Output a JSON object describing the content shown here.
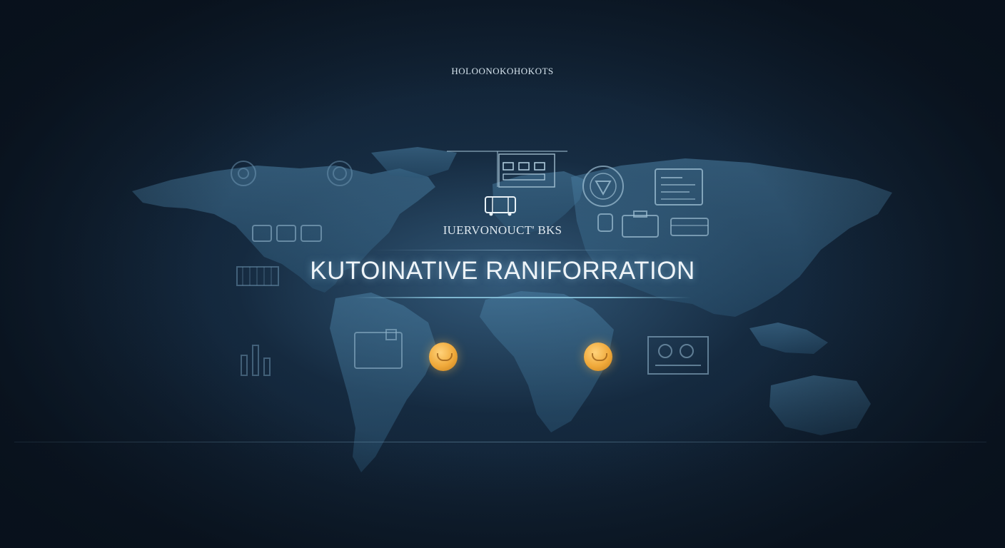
{
  "header": {
    "caption": "HOLOONOKOHOKOTS"
  },
  "hero": {
    "subtitle": "IUERVONOUCT' BKS",
    "title": "KUTOINATIVE RANIFORRATION"
  },
  "colors": {
    "background": "#0f1e2d",
    "map": "#3d6f93",
    "accent_gold": "#f0a93a",
    "text": "#eef4f8"
  },
  "icons": [
    "monitor-icon",
    "dashboard-panel-icon",
    "shield-badge-icon",
    "document-window-icon",
    "briefcase-icon",
    "vehicle-icon",
    "gear-icon",
    "server-rack-icon",
    "network-node-icon",
    "chart-board-icon",
    "device-icon",
    "toolbox-icon"
  ]
}
